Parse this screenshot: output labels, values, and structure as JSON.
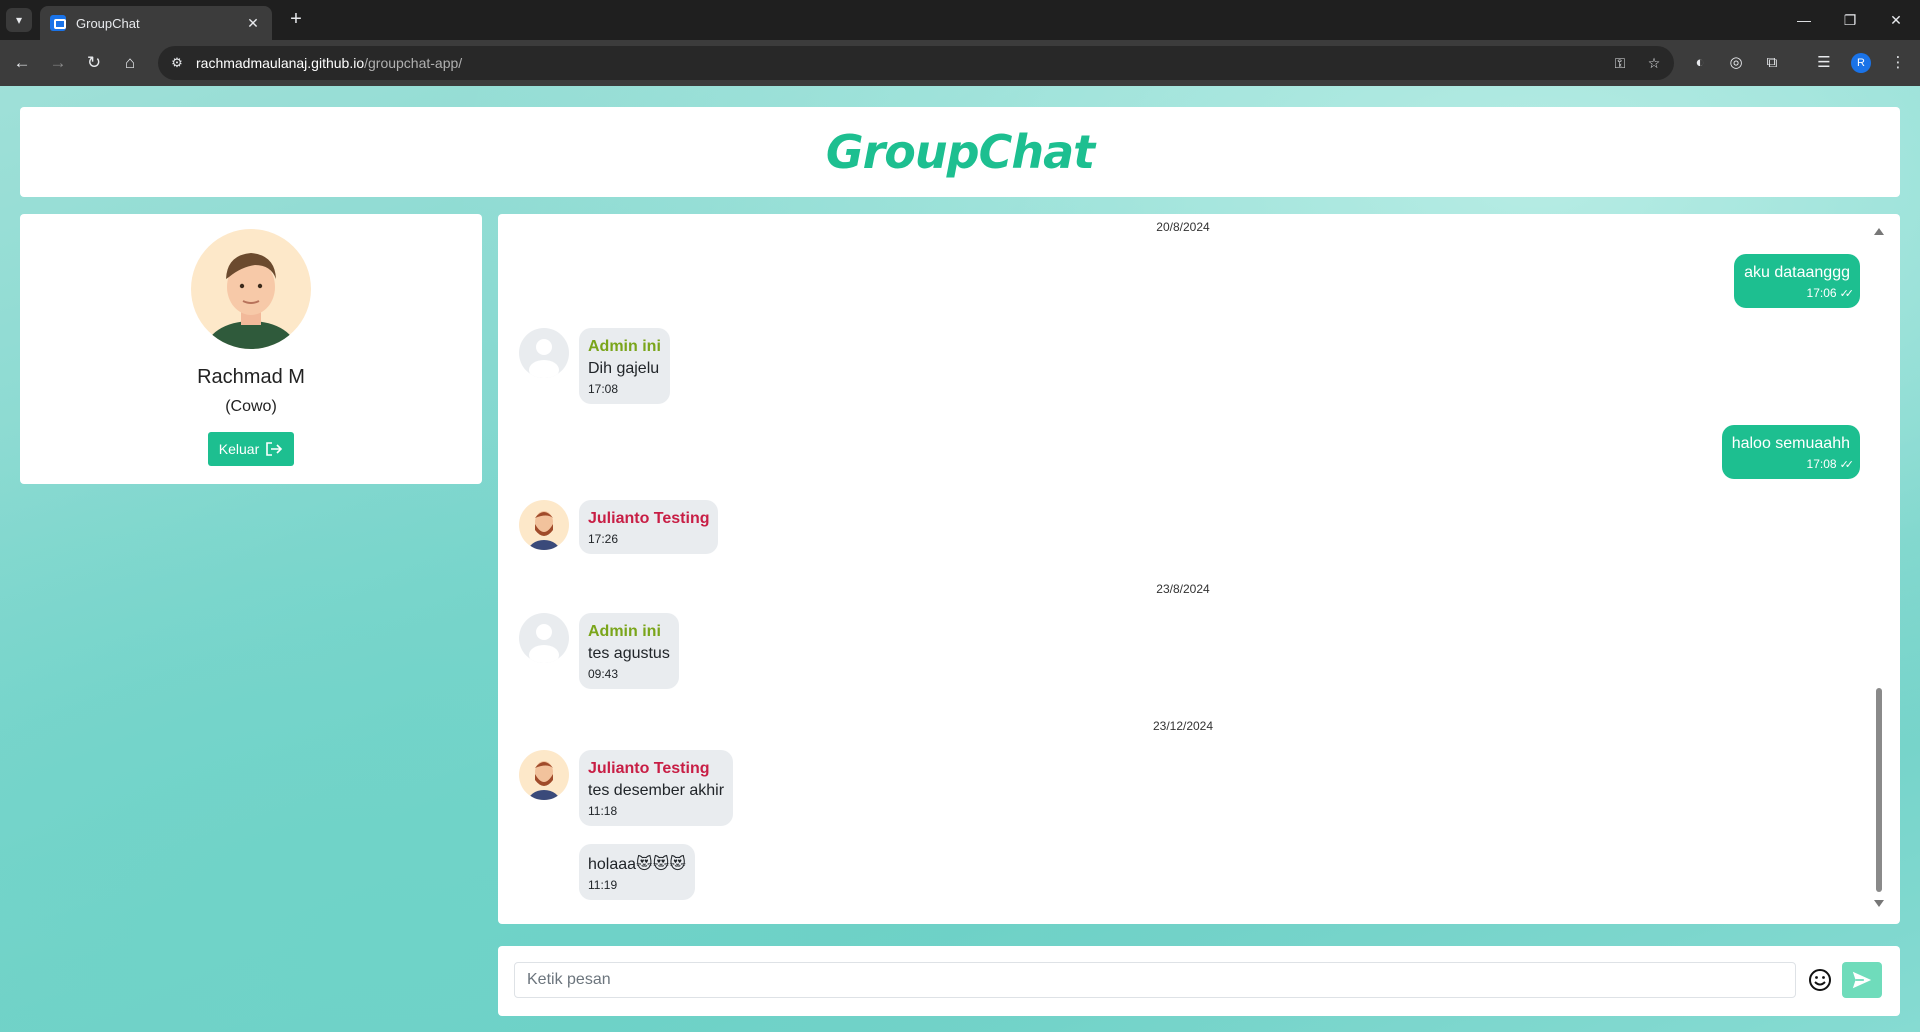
{
  "browser": {
    "tab_title": "GroupChat",
    "url_host": "rachmadmaulanaj.github.io",
    "url_path": "/groupchat-app/",
    "profile_initial": "R"
  },
  "app": {
    "title": "GroupChat"
  },
  "profile": {
    "name": "Rachmad M",
    "gender": "(Cowo)",
    "logout_label": "Keluar"
  },
  "chat": {
    "messages": [
      {
        "type": "date",
        "text": "20/8/2024"
      },
      {
        "type": "out",
        "text": "aku dataanggg",
        "time": "17:06"
      },
      {
        "type": "in",
        "sender": "Admin ini",
        "text": "Dih gajelu",
        "time": "17:08"
      },
      {
        "type": "out",
        "text": "haloo semuaahh",
        "time": "17:08"
      },
      {
        "type": "in",
        "sender": "Julianto Testing",
        "text": "",
        "time": "17:26"
      },
      {
        "type": "date",
        "text": "23/8/2024"
      },
      {
        "type": "in",
        "sender": "Admin ini",
        "text": "tes agustus",
        "time": "09:43"
      },
      {
        "type": "date",
        "text": "23/12/2024"
      },
      {
        "type": "in",
        "sender": "Julianto Testing",
        "text": "tes desember akhir",
        "time": "11:18"
      },
      {
        "type": "in",
        "sender": "",
        "text": "holaaa😻😻😻",
        "time": "11:19"
      }
    ]
  },
  "composer": {
    "placeholder": "Ketik pesan"
  },
  "colors": {
    "accent": "#1dbf90",
    "admin_name": "#7aa51a",
    "julianto_name": "#c81e45"
  }
}
